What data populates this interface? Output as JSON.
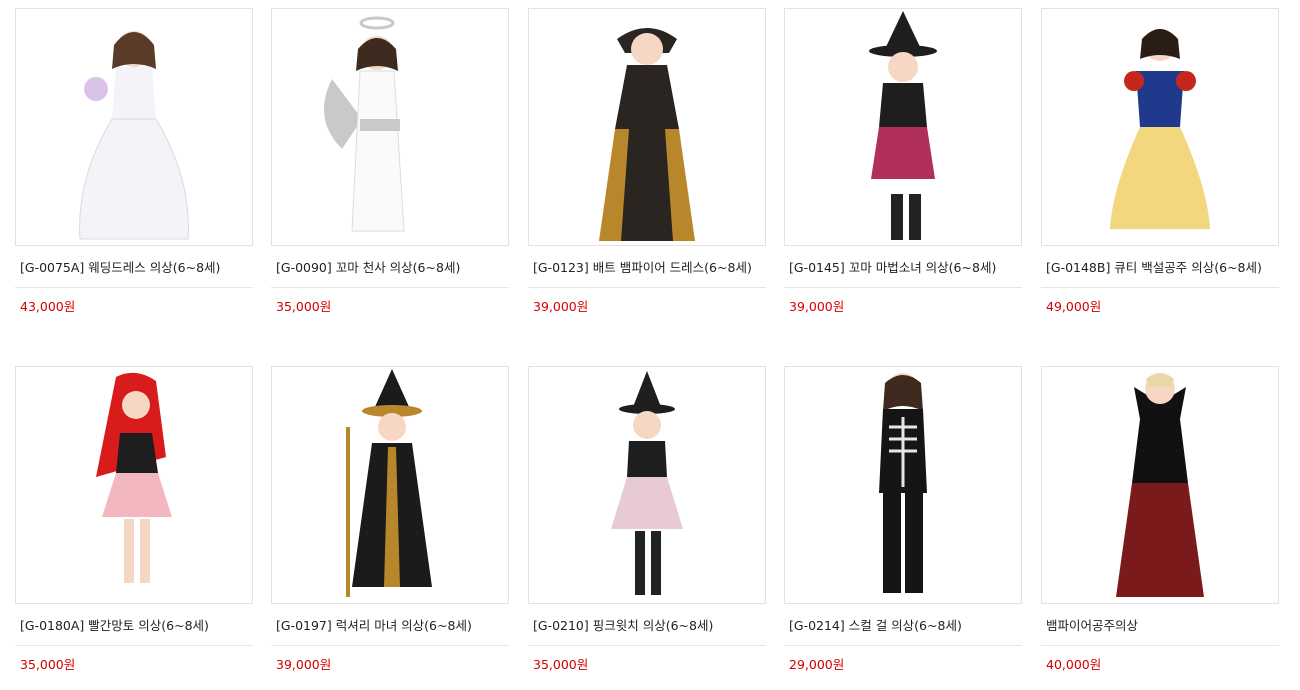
{
  "products": [
    {
      "name": "[G-0075A] 웨딩드레스 의상(6~8세)",
      "price": "43,000원",
      "image": "wedding-dress-costume",
      "colors": {
        "dress": "#f4f4f8",
        "accent": "#d9c3e6",
        "hair": "#5a3a28"
      }
    },
    {
      "name": "[G-0090] 꼬마 천사 의상(6~8세)",
      "price": "35,000원",
      "image": "angel-costume",
      "colors": {
        "dress": "#fafafa",
        "accent": "#c9c9c9",
        "hair": "#3e2a1e"
      }
    },
    {
      "name": "[G-0123] 배트 뱀파이어 드레스(6~8세)",
      "price": "39,000원",
      "image": "bat-vampire-dress",
      "colors": {
        "dress": "#2a2520",
        "accent": "#b8872c",
        "hair": "#3e2a1e"
      }
    },
    {
      "name": "[G-0145] 꼬마 마법소녀 의상(6~8세)",
      "price": "39,000원",
      "image": "little-witch-costume",
      "colors": {
        "dress": "#1e1e1e",
        "accent": "#b0305a",
        "hair": "#3e2a1e"
      }
    },
    {
      "name": "[G-0148B] 큐티 백설공주 의상(6~8세)",
      "price": "49,000원",
      "image": "snow-white-costume",
      "colors": {
        "dress": "#f2d77e",
        "accent": "#1f3a8c",
        "hair": "#2a1d16"
      }
    },
    {
      "name": "[G-0180A] 빨간망토 의상(6~8세)",
      "price": "35,000원",
      "image": "red-riding-hood-costume",
      "colors": {
        "dress": "#f3b7c0",
        "accent": "#d81c1c",
        "hair": "#3e2a1e"
      }
    },
    {
      "name": "[G-0197] 럭셔리 마녀 의상(6~8세)",
      "price": "39,000원",
      "image": "luxury-witch-costume",
      "colors": {
        "dress": "#1b1b1b",
        "accent": "#b8872c",
        "hair": "#3e2a1e"
      }
    },
    {
      "name": "[G-0210] 핑크윗치 의상(6~8세)",
      "price": "35,000원",
      "image": "pink-witch-costume",
      "colors": {
        "dress": "#e8c9d6",
        "accent": "#1e1e1e",
        "hair": "#3e2a1e"
      }
    },
    {
      "name": "[G-0214] 스컬 걸 의상(6~8세)",
      "price": "29,000원",
      "image": "skull-girl-costume",
      "colors": {
        "dress": "#151515",
        "accent": "#e6e6e6",
        "hair": "#3e2a1e"
      }
    },
    {
      "name": "뱀파이어공주의상",
      "price": "40,000원",
      "image": "vampire-princess-costume",
      "colors": {
        "dress": "#7a1a1a",
        "accent": "#111111",
        "hair": "#e8d7a8"
      }
    }
  ]
}
